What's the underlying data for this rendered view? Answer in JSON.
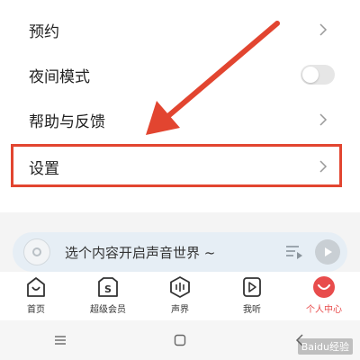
{
  "menu": {
    "items": [
      {
        "label": "预约",
        "control": "chevron"
      },
      {
        "label": "夜间模式",
        "control": "toggle",
        "toggle_on": false
      },
      {
        "label": "帮助与反馈",
        "control": "chevron"
      },
      {
        "label": "设置",
        "control": "chevron"
      }
    ]
  },
  "annotation": {
    "color": "#e24530"
  },
  "player": {
    "prompt": "选个内容开启声音世界 ~"
  },
  "tabbar": {
    "tabs": [
      {
        "label": "首页",
        "icon": "home-icon"
      },
      {
        "label": "超级会员",
        "icon": "vip-icon"
      },
      {
        "label": "声界",
        "icon": "sound-world-icon"
      },
      {
        "label": "我听",
        "icon": "my-listen-icon"
      },
      {
        "label": "个人中心",
        "icon": "profile-icon",
        "active": true
      }
    ],
    "active_color": "#e84c4c"
  },
  "system_nav": {
    "icons": [
      "menu-icon",
      "home-square-icon",
      "back-icon"
    ]
  },
  "watermark": {
    "text": "Baidu经验"
  }
}
